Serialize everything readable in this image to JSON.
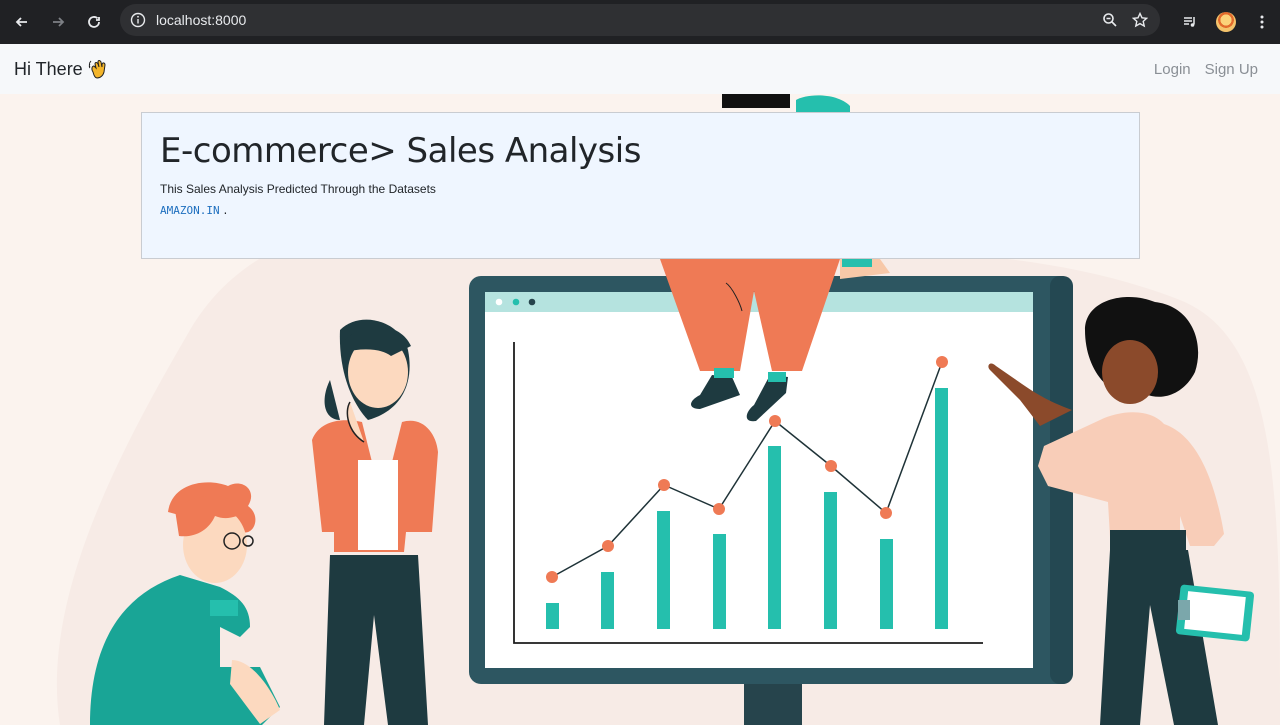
{
  "browser": {
    "url": "localhost:8000"
  },
  "navbar": {
    "brand": "Hi There",
    "links": {
      "login": "Login",
      "signup": "Sign Up"
    }
  },
  "card": {
    "title": "E-commerce> Sales Analysis",
    "subtitle": "This Sales Analysis Predicted Through the Datasets",
    "source_link": "AMAZON.IN",
    "source_suffix": "."
  },
  "colors": {
    "chart_bar": "#25bfad",
    "chart_point": "#ef7a55",
    "monitor": "#2d5661",
    "accent_link": "#1e6fbf"
  }
}
